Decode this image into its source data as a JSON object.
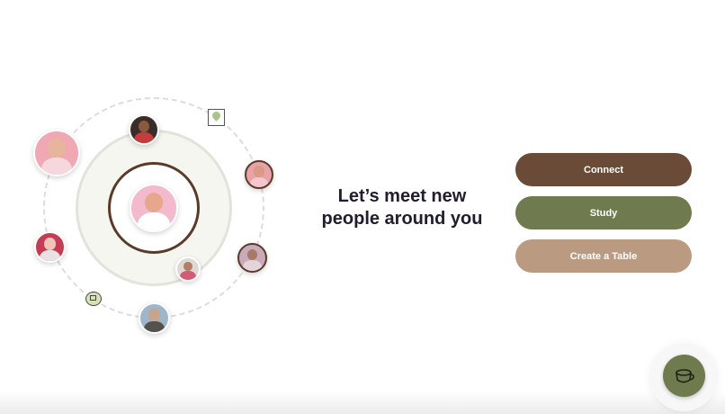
{
  "headline": {
    "line1": "Let’s meet new",
    "line2": "people around you"
  },
  "actions": {
    "connect_label": "Connect",
    "study_label": "Study",
    "create_table_label": "Create a Table"
  },
  "colors": {
    "connect": "#6a4b38",
    "study": "#6f7b4e",
    "create_table": "#bb9a82",
    "headline_text": "#231b2e",
    "orbit_ring": "#5a3b2a"
  },
  "icons": {
    "map_pin": "map-pin-icon",
    "chat": "chat-icon",
    "fab": "coffee-cup-icon"
  }
}
